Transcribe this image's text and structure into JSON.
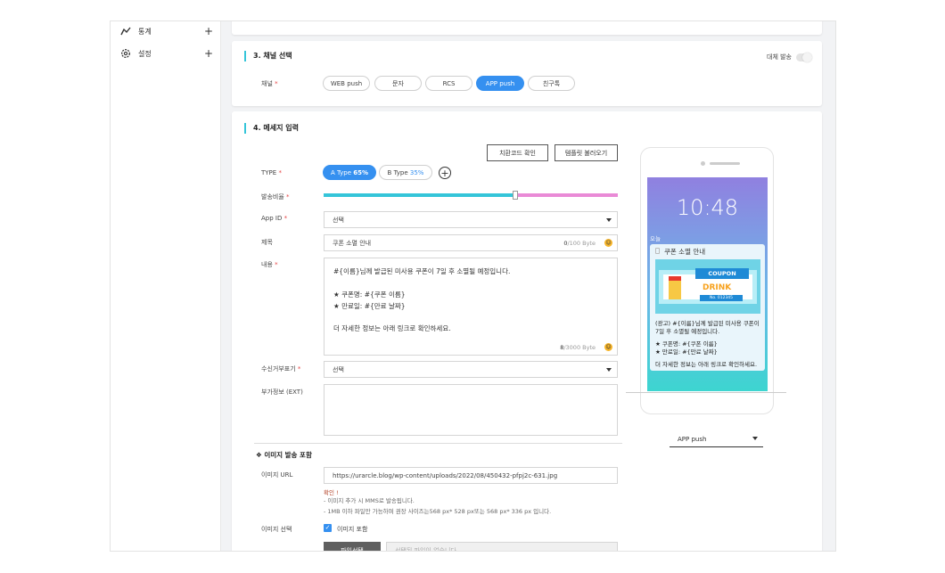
{
  "sidebar": {
    "items": [
      {
        "label": "통계",
        "icon": "chart-line-icon",
        "action": "+"
      },
      {
        "label": "설정",
        "icon": "gear-icon",
        "action": "+"
      }
    ]
  },
  "channel": {
    "title": "3. 채널 선택",
    "substitute_label": "대체 발송",
    "field_label": "채널",
    "options": [
      "WEB push",
      "문자",
      "RCS",
      "APP push",
      "친구톡"
    ],
    "selected": "APP push"
  },
  "message": {
    "title": "4. 메세지 입력",
    "btn_replace": "치환코드 확인",
    "btn_template": "템플릿 불러오기",
    "type_label": "TYPE",
    "type_a": "A Type",
    "type_a_pct": "65%",
    "type_b": "B Type",
    "type_b_pct": "35%",
    "type_a_ratio": 0.65,
    "ratio_label": "발송비율",
    "appid_label": "App ID",
    "appid_value": "선택",
    "subject_label": "제목",
    "subject_value": "쿠폰 소멸 안내",
    "subject_count": "0",
    "subject_max": "/100 Byte",
    "content_label": "내용",
    "content_lines": [
      "#{이름}님께 발급된 미사용 쿠폰이 7일 후 소멸될 예정입니다.",
      "★ 쿠폰명: #{쿠폰 이름}",
      "★ 만료일: #{만료 날짜}",
      "더 자세한 정보는 아래 링크로 확인하세요."
    ],
    "content_count": "8",
    "content_max": "/3000 Byte",
    "reject_label": "수신거부표기",
    "reject_value": "선택",
    "ext_label": "부가정보 (EXT)"
  },
  "image": {
    "title": "❖ 이미지 발송 포함",
    "url_label": "이미지 URL",
    "url_value": "https://urarcle.blog/wp-content/uploads/2022/08/450432-pfpj2c-631.jpg",
    "note_title": "확인 !",
    "note_1": "- 이미지 추가 시 MMS로 발송됩니다.",
    "note_2": "- 1MB 이하 파일만 가능하며 권장 사이즈는568 px* 528 px또는 568 px* 336 px 입니다.",
    "select_label": "이미지 선택",
    "include_label": "이미지 포함",
    "file_button": "파일선택",
    "file_placeholder": "선택된 파일이 없습니다."
  },
  "preview": {
    "time": "10:48",
    "today": "오늘",
    "notif_title": "쿠폰 소멸 안내",
    "coupon_text": "COUPON",
    "drink_text": "DRINK",
    "coupon_no": "No. 012345",
    "body_1": "(광고) #{이름}님께 발급된 미사용 쿠폰이",
    "body_2": "7일 후 소멸될 예정입니다.",
    "body_3": "★ 쿠폰명: #{쿠폰 이름}",
    "body_4": "★ 만료일: #{만료 날짜}",
    "body_5": "더 자세한 정보는 아래 링크로 확인하세요.",
    "select_value": "APP push"
  },
  "colors": {
    "accent": "#3590f0",
    "teal": "#35c5d9",
    "pink": "#e98ad6"
  }
}
